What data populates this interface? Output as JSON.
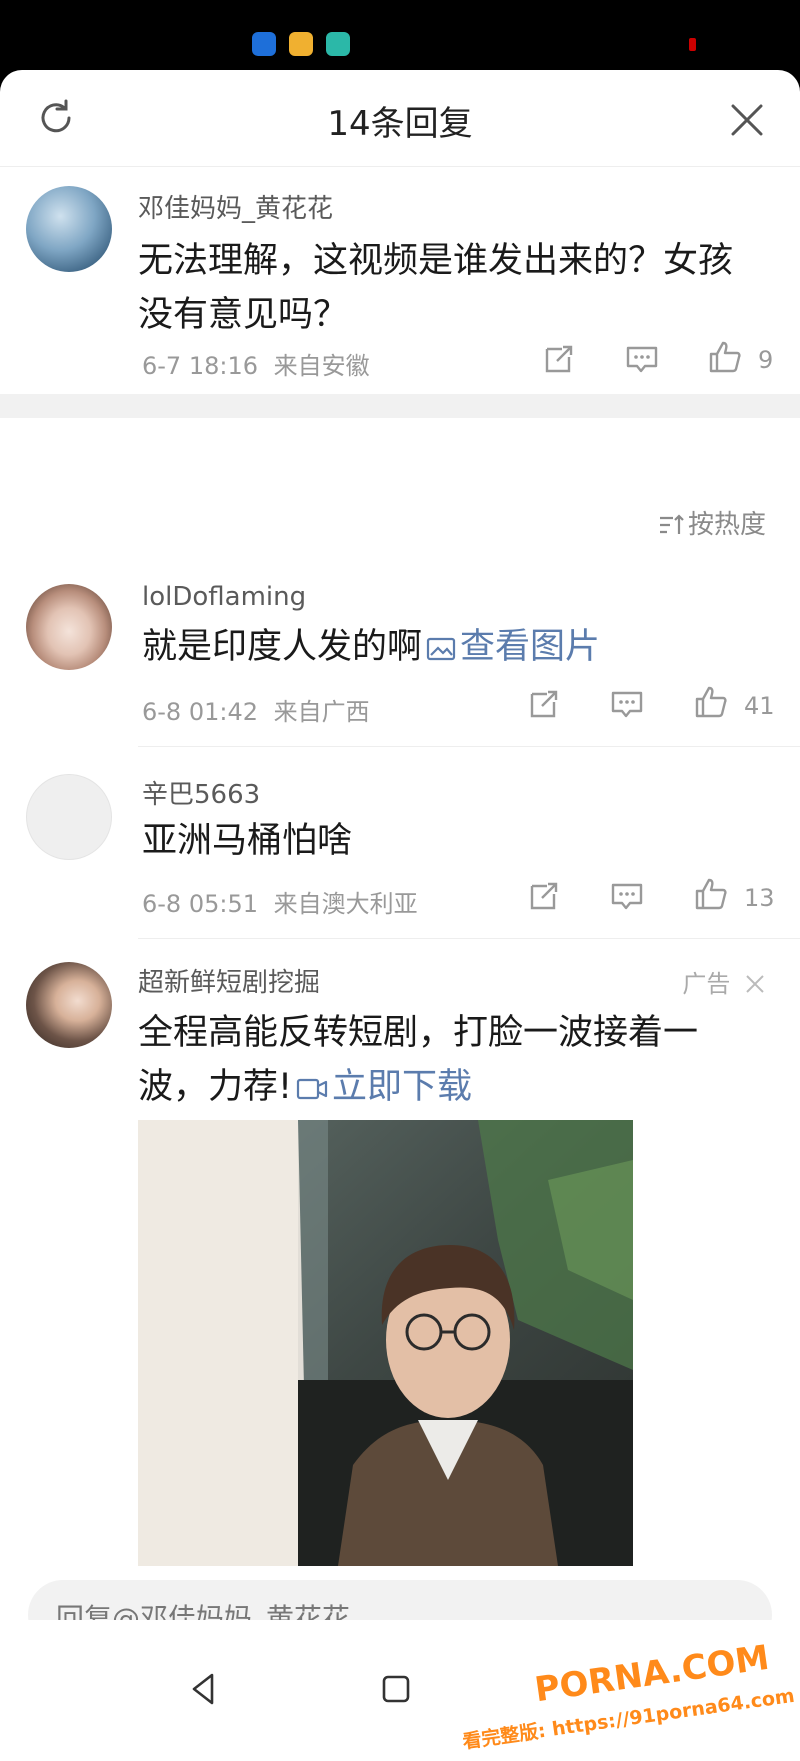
{
  "header": {
    "title": "14条回复"
  },
  "main_comment": {
    "username": "邓佳妈妈_黄花花",
    "text": "无法理解，这视频是谁发出来的？女孩没有意见吗？",
    "time": "6-7 18:16",
    "location": "来自安徽",
    "likes": "9"
  },
  "sort": {
    "label": "按热度"
  },
  "replies": [
    {
      "username": "lolDoflaming",
      "text": "就是印度人发的啊",
      "link": "查看图片",
      "time": "6-8 01:42",
      "location": "来自广西",
      "likes": "41"
    },
    {
      "username": "辛巴5663",
      "text": "亚洲马桶怕啥",
      "time": "6-8 05:51",
      "location": "来自澳大利亚",
      "likes": "13"
    }
  ],
  "ad": {
    "username": "超新鲜短剧挖掘",
    "tag": "广告",
    "text": "全程高能反转短剧，打脸一波接着一波，力荐!",
    "link": "立即下载"
  },
  "reply_bar": {
    "placeholder": "回复@邓佳妈妈_黄花花"
  },
  "watermark": {
    "brand": "PORNA.COM",
    "sub": "看完整版: https://91porna64.com"
  },
  "colors": {
    "link": "#5b7cad",
    "watermark": "#ff8a1a",
    "separator": "#f1f1f1"
  }
}
